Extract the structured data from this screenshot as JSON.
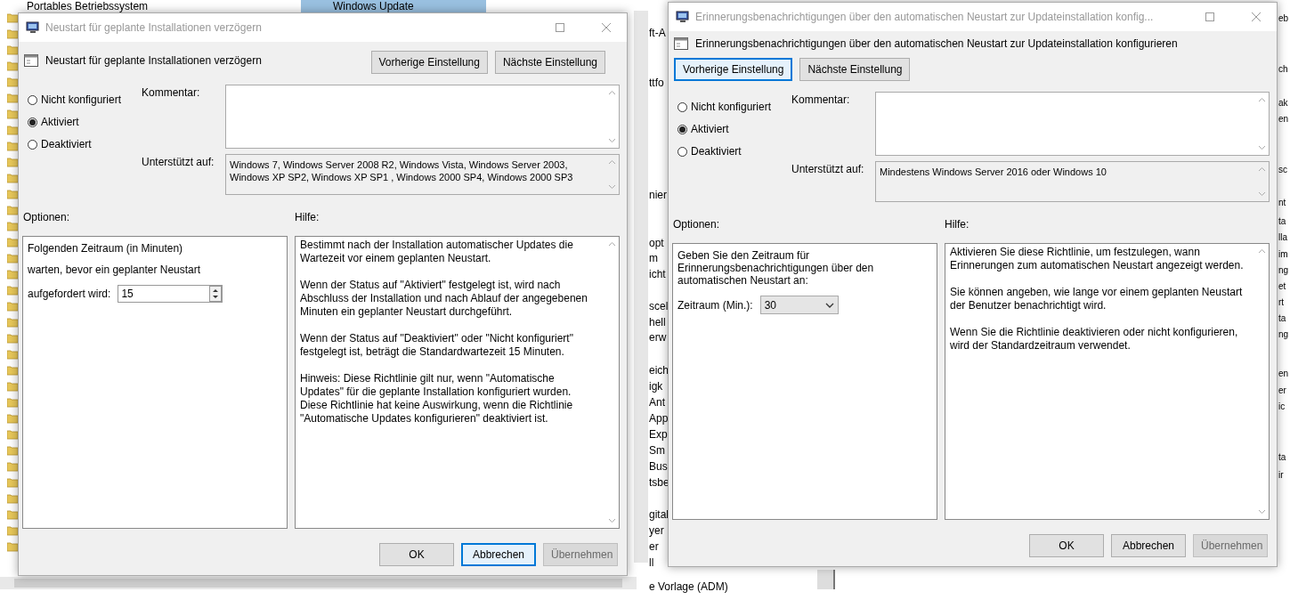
{
  "background": {
    "tree_item": "Portables Betriebssystem",
    "selected_tab": "Windows Update",
    "middle_fragments": [
      "ft-A",
      "ttfo",
      "nier",
      "opt",
      "m",
      "icht",
      "scel",
      "hell",
      "erw",
      "eich",
      "igk",
      "Ant",
      "App",
      "Exp",
      "Sm",
      "Bus",
      "tsbe",
      "gital",
      "yer",
      "er",
      "ll"
    ],
    "bottom_fragment": "e Vorlage (ADM)",
    "right_fragments": [
      "eb",
      "ch",
      "ak",
      "en",
      "sc",
      "nt",
      "ta",
      "lla",
      "im",
      "ng",
      "et",
      "rt",
      "ta",
      "ng",
      "en",
      "er",
      "ic",
      "ta",
      "ir"
    ]
  },
  "dialogs": [
    {
      "window_title": "Neustart für geplante Installationen verzögern",
      "heading": "Neustart für geplante Installationen verzögern",
      "nav_buttons": [
        {
          "label": "Vorherige Einstellung",
          "focused": false
        },
        {
          "label": "Nächste Einstellung",
          "focused": false
        }
      ],
      "states": [
        {
          "label": "Nicht konfiguriert",
          "selected": false
        },
        {
          "label": "Aktiviert",
          "selected": true
        },
        {
          "label": "Deaktiviert",
          "selected": false
        }
      ],
      "comment_label": "Kommentar:",
      "supported_label": "Unterstützt auf:",
      "supported_on": "Windows 7, Windows Server 2008 R2, Windows Vista, Windows Server 2003, Windows XP SP2, Windows XP SP1 , Windows 2000 SP4, Windows 2000 SP3",
      "options_label": "Optionen:",
      "help_label": "Hilfe:",
      "options": [
        {
          "kind": "text",
          "text": "Folgenden Zeitraum (in Minuten)"
        },
        {
          "kind": "text",
          "text": "warten, bevor ein geplanter Neustart"
        },
        {
          "kind": "spin",
          "label": "aufgefordert wird:",
          "value": "15"
        }
      ],
      "help": [
        "Bestimmt nach der Installation automatischer Updates die Wartezeit vor einem geplanten Neustart.",
        "Wenn der Status auf \"Aktiviert\" festgelegt ist, wird nach Abschluss der Installation und nach Ablauf der angegebenen Minuten ein geplanter Neustart durchgeführt.",
        "Wenn der Status auf \"Deaktiviert\" oder \"Nicht konfiguriert\" festgelegt ist, beträgt die Standardwartezeit 15 Minuten.",
        "Hinweis: Diese Richtlinie gilt nur, wenn \"Automatische Updates\" für die geplante Installation konfiguriert wurden. Diese Richtlinie hat keine Auswirkung, wenn die Richtlinie \"Automatische Updates konfigurieren\" deaktiviert ist."
      ],
      "buttons": [
        {
          "label": "OK",
          "focused": false,
          "disabled": false
        },
        {
          "label": "Abbrechen",
          "focused": true,
          "disabled": false
        },
        {
          "label": "Übernehmen",
          "focused": false,
          "disabled": true
        }
      ]
    },
    {
      "window_title": "Erinnerungsbenachrichtigungen über den automatischen Neustart zur Updateinstallation konfig...",
      "heading": "Erinnerungsbenachrichtigungen über den automatischen Neustart zur Updateinstallation konfigurieren",
      "nav_buttons": [
        {
          "label": "Vorherige Einstellung",
          "focused": true
        },
        {
          "label": "Nächste Einstellung",
          "focused": false
        }
      ],
      "states": [
        {
          "label": "Nicht konfiguriert",
          "selected": false
        },
        {
          "label": "Aktiviert",
          "selected": true
        },
        {
          "label": "Deaktiviert",
          "selected": false
        }
      ],
      "comment_label": "Kommentar:",
      "supported_label": "Unterstützt auf:",
      "supported_on": "Mindestens Windows Server 2016 oder Windows 10",
      "options_label": "Optionen:",
      "help_label": "Hilfe:",
      "options": [
        {
          "kind": "text",
          "text": "Geben Sie den Zeitraum für Erinnerungsbenachrichtigungen über den automatischen Neustart an:"
        },
        {
          "kind": "dropdown",
          "label": "Zeitraum (Min.):",
          "value": "30"
        }
      ],
      "help": [
        "Aktivieren Sie diese Richtlinie, um festzulegen, wann Erinnerungen zum automatischen Neustart angezeigt werden.",
        "Sie können angeben, wie lange vor einem geplanten Neustart der Benutzer benachrichtigt wird.",
        "Wenn Sie die Richtlinie deaktivieren oder nicht konfigurieren, wird der Standardzeitraum verwendet."
      ],
      "buttons": [
        {
          "label": "OK",
          "focused": false,
          "disabled": false
        },
        {
          "label": "Abbrechen",
          "focused": false,
          "disabled": false
        },
        {
          "label": "Übernehmen",
          "focused": false,
          "disabled": true
        }
      ]
    }
  ]
}
